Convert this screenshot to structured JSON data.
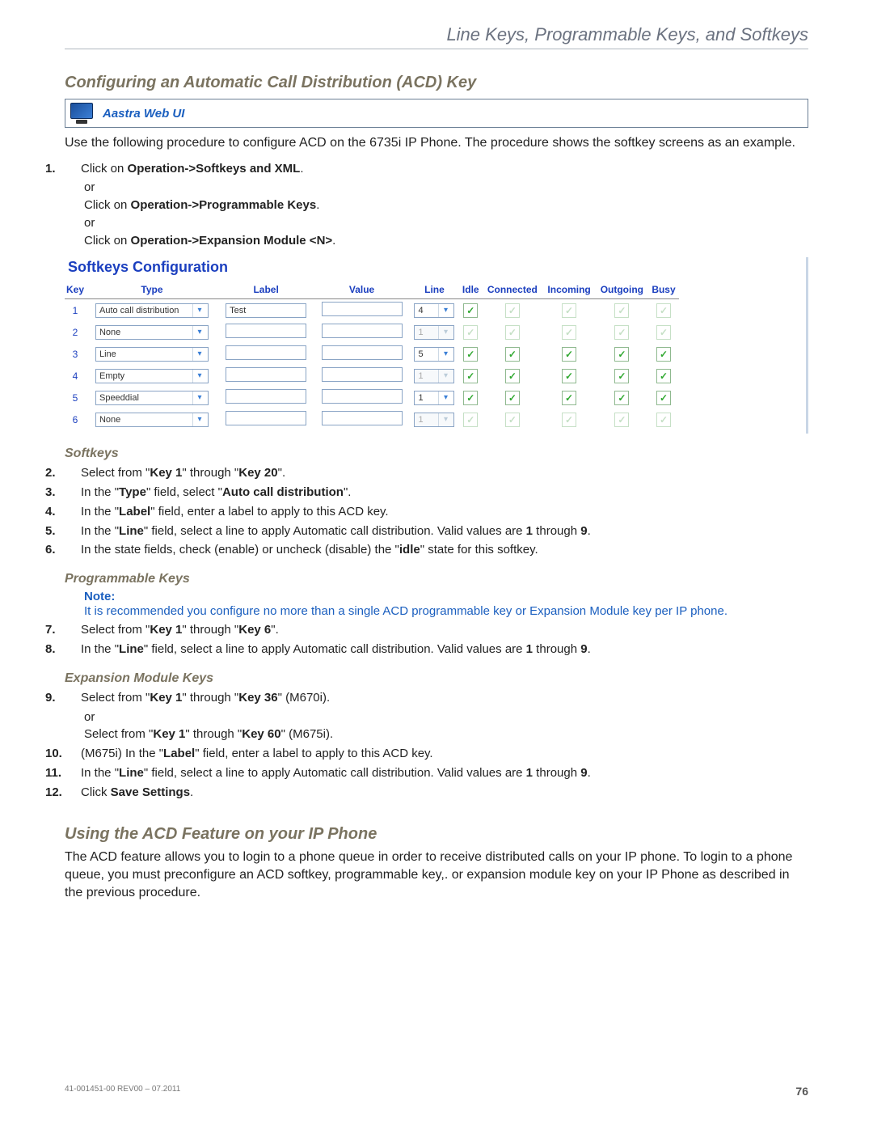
{
  "chapter": "Line Keys, Programmable Keys, and Softkeys",
  "heading_config": "Configuring an Automatic Call Distribution (ACD) Key",
  "webui_label": "Aastra Web UI",
  "intro_body": "Use the following procedure to configure ACD on the 6735i IP Phone. The procedure shows the softkey screens as an example.",
  "step1": {
    "num": "1.",
    "pre": "Click on ",
    "b1": "Operation->Softkeys and XML",
    "after1": ".",
    "or1": "or",
    "pre2": "Click on ",
    "b2": "Operation->Programmable Keys",
    "after2": ".",
    "or2": "or",
    "pre3": "Click on ",
    "b3": "Operation->Expansion Module <N>",
    "after3": "."
  },
  "softkeys_panel": {
    "title": "Softkeys Configuration",
    "cols": [
      "Key",
      "Type",
      "Label",
      "Value",
      "Line",
      "Idle",
      "Connected",
      "Incoming",
      "Outgoing",
      "Busy"
    ],
    "rows": [
      {
        "key": "1",
        "type": "Auto call distribution",
        "label": "Test",
        "value": "",
        "line": "4",
        "line_dis": false,
        "idle": "on",
        "connected": "dim",
        "incoming": "dim",
        "outgoing": "dim",
        "busy": "dim"
      },
      {
        "key": "2",
        "type": "None",
        "label": "",
        "value": "",
        "line": "1",
        "line_dis": true,
        "idle": "dim",
        "connected": "dim",
        "incoming": "dim",
        "outgoing": "dim",
        "busy": "dim"
      },
      {
        "key": "3",
        "type": "Line",
        "label": "",
        "value": "",
        "line": "5",
        "line_dis": false,
        "idle": "on",
        "connected": "on",
        "incoming": "on",
        "outgoing": "on",
        "busy": "on"
      },
      {
        "key": "4",
        "type": "Empty",
        "label": "",
        "value": "",
        "line": "1",
        "line_dis": true,
        "idle": "on",
        "connected": "on",
        "incoming": "on",
        "outgoing": "on",
        "busy": "on"
      },
      {
        "key": "5",
        "type": "Speeddial",
        "label": "",
        "value": "",
        "line": "1",
        "line_dis": false,
        "idle": "on",
        "connected": "on",
        "incoming": "on",
        "outgoing": "on",
        "busy": "on"
      },
      {
        "key": "6",
        "type": "None",
        "label": "",
        "value": "",
        "line": "1",
        "line_dis": true,
        "idle": "dim",
        "connected": "dim",
        "incoming": "dim",
        "outgoing": "dim",
        "busy": "dim"
      }
    ]
  },
  "h3_softkeys": "Softkeys",
  "step2": {
    "num": "2.",
    "t1": "Select from \"",
    "b1": "Key 1",
    "t2": "\" through \"",
    "b2": "Key 20",
    "t3": "\"."
  },
  "step3": {
    "num": "3.",
    "t1": "In the \"",
    "b1": "Type",
    "t2": "\" field, select \"",
    "b2": "Auto call distribution",
    "t3": "\"."
  },
  "step4": {
    "num": "4.",
    "t1": "In the \"",
    "b1": "Label",
    "t2": "\" field, enter a label to apply to this ACD key."
  },
  "step5": {
    "num": "5.",
    "t1": "In the \"",
    "b1": "Line",
    "t2": "\" field, select a line to apply Automatic call distribution. Valid values are ",
    "b2": "1",
    "t3": " through ",
    "b3": "9",
    "t4": "."
  },
  "step6": {
    "num": "6.",
    "t1": "In the state fields, check (enable) or uncheck (disable) the \"",
    "b1": "idle",
    "t2": "\" state for this softkey."
  },
  "h3_prog": "Programmable Keys",
  "note_label": "Note:",
  "note_body": "It is recommended you configure no more than a single ACD programmable key or Expansion Module key per IP phone.",
  "step7": {
    "num": "7.",
    "t1": "Select from \"",
    "b1": "Key 1",
    "t2": "\" through \"",
    "b2": "Key 6",
    "t3": "\"."
  },
  "step8": {
    "num": "8.",
    "t1": "In the \"",
    "b1": "Line",
    "t2": "\" field, select a line to apply Automatic call distribution. Valid values are ",
    "b2": "1",
    "t3": " through ",
    "b3": "9",
    "t4": "."
  },
  "h3_exp": "Expansion Module Keys",
  "step9": {
    "num": "9.",
    "t1": "Select from \"",
    "b1": "Key 1",
    "t2": "\" through \"",
    "b2": "Key 36",
    "t3": "\" (M670i).",
    "or": "or",
    "t4": "Select from \"",
    "b3": "Key 1",
    "t5": "\" through \"",
    "b4": "Key 60",
    "t6": "\" (M675i)."
  },
  "step10": {
    "num": "10.",
    "t1": "(M675i) In the \"",
    "b1": "Label",
    "t2": "\" field, enter a label to apply to this ACD key."
  },
  "step11": {
    "num": "11.",
    "t1": "In the \"",
    "b1": "Line",
    "t2": "\" field, select a line to apply Automatic call distribution. Valid values are ",
    "b2": "1",
    "t3": " through ",
    "b3": "9",
    "t4": ". "
  },
  "step12": {
    "num": "12.",
    "t1": "Click ",
    "b1": "Save Settings",
    "t2": "."
  },
  "heading_using": "Using the ACD Feature on your IP Phone",
  "using_body": "The ACD feature allows you to login to a phone queue in order to receive distributed calls on your IP phone. To login to a phone queue, you must preconfigure an ACD softkey, programmable key,. or expansion module key on your IP Phone as described in the previous procedure.",
  "footer_doc": "41-001451-00 REV00 – 07.2011",
  "footer_page": "76"
}
